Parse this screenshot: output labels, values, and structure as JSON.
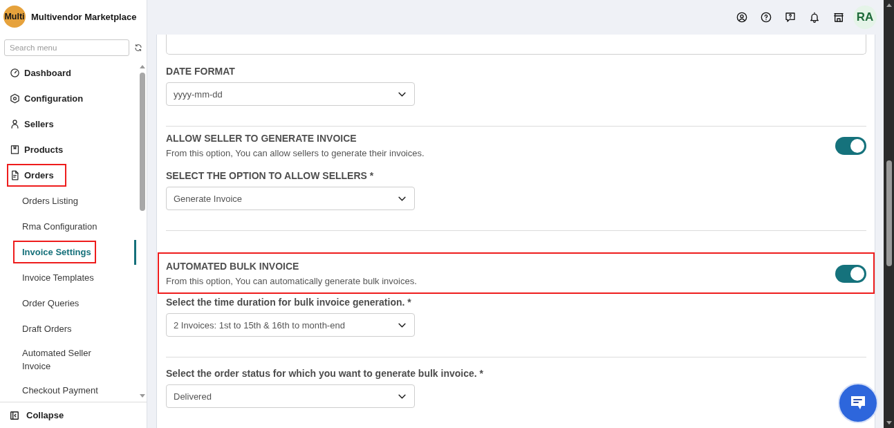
{
  "sidebar": {
    "logo_text": "Multi",
    "title": "Multivendor Marketplace",
    "search": {
      "placeholder": "Search menu"
    },
    "items": [
      {
        "label": "Dashboard",
        "selected": false,
        "highlighted": false
      },
      {
        "label": "Configuration",
        "selected": false,
        "highlighted": false
      },
      {
        "label": "Sellers",
        "selected": false,
        "highlighted": false
      },
      {
        "label": "Products",
        "selected": false,
        "highlighted": false
      },
      {
        "label": "Orders",
        "selected": false,
        "highlighted": true,
        "children": [
          {
            "label": "Orders Listing",
            "selected": false,
            "highlighted": false
          },
          {
            "label": "Rma Configuration",
            "selected": false,
            "highlighted": false
          },
          {
            "label": "Invoice Settings",
            "selected": true,
            "highlighted": true
          },
          {
            "label": "Invoice Templates",
            "selected": false,
            "highlighted": false
          },
          {
            "label": "Order Queries",
            "selected": false,
            "highlighted": false
          },
          {
            "label": "Draft Orders",
            "selected": false,
            "highlighted": false
          },
          {
            "label": "Automated Seller Invoice",
            "selected": false,
            "highlighted": false
          },
          {
            "label": "Checkout Payment",
            "selected": false,
            "highlighted": false
          }
        ]
      }
    ],
    "collapse_label": "Collapse"
  },
  "topbar": {
    "avatar_initials": "RA"
  },
  "settings": {
    "sections": [
      {
        "items": [
          {
            "kind": "textarea"
          },
          {
            "kind": "select",
            "label": "DATE FORMAT",
            "value": "yyyy-mm-dd"
          }
        ]
      },
      {
        "items": [
          {
            "kind": "toggle",
            "title": "ALLOW SELLER TO GENERATE INVOICE",
            "description": "From this option, You can allow sellers to generate their invoices.",
            "on": true,
            "highlighted": false
          },
          {
            "kind": "select",
            "label": "SELECT THE OPTION TO ALLOW SELLERS *",
            "value": "Generate Invoice"
          }
        ]
      },
      {
        "items": [
          {
            "kind": "toggle",
            "title": "AUTOMATED BULK INVOICE",
            "description": "From this option, You can automatically generate bulk invoices.",
            "on": true,
            "highlighted": true
          },
          {
            "kind": "select",
            "label": "Select the time duration for bulk invoice generation. *",
            "value": "2 Invoices: 1st to 15th & 16th to month-end"
          }
        ]
      },
      {
        "items": [
          {
            "kind": "select",
            "label": "Select the order status for which you want to generate bulk invoice. *",
            "value": "Delivered"
          }
        ]
      }
    ]
  }
}
